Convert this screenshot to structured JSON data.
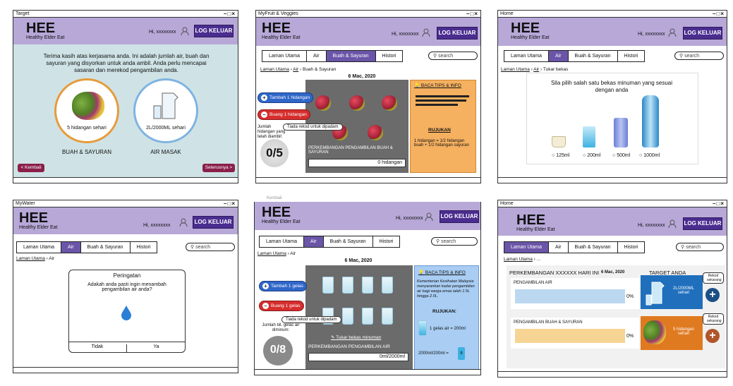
{
  "app": {
    "logo": "HEE",
    "tagline": "Healthy Elder Eat",
    "greeting": "Hi, xxxxxxxx",
    "logout": "LOG KELUAR",
    "search": "search"
  },
  "tabs": [
    "Laman Utama",
    "Air",
    "Buah & Sayuran",
    "Histori"
  ],
  "colors": {
    "header": "#b7a8d8",
    "accent": "#4a2d8f",
    "tab_active": "#6a55a8",
    "add_green_bg": "#2f66c9",
    "minus_red": "#d62d2d",
    "info_orange": "#f5b060",
    "info_blue": "#a9cdf3",
    "dark_panel": "#6b6b6b",
    "bar_blue": "#bcd8f0",
    "bar_orange": "#f6d494",
    "target_water": "#1f6fbd",
    "target_fruit": "#e07a20"
  },
  "w1": {
    "title": "Target",
    "intro": "Terima kasih atas kerjasama anda. Ini adalah jumlah air, buah dan sayuran yang disyorkan untuk anda ambil. Anda perlu mencapai sasaran dan merekod pengambilan anda.",
    "fruit_circle": "5 hidangan sehari",
    "water_circle": "2L/2000ML sehari",
    "fruit_label": "BUAH & SAYURAN",
    "water_label": "AIR MASAK",
    "back": "< Kembali",
    "next": "Seterusnya >"
  },
  "w2": {
    "title": "MyFruit & Veggies",
    "crumb_home": "Laman Utama",
    "crumb_air": "Air",
    "crumb_here": "Buah & Sayuran",
    "date": "6 Mac, 2020",
    "add": "Tambah 1 hidangan",
    "remove": "Buang 1 hidangan",
    "count_label": "Jumlah hidangan yang telah diambil:",
    "tooltip": "Tiada rekod untuk dipadam",
    "count": "0/5",
    "progress_label": "PERKEMBANGAN PENGAMBILAN BUAH & SAYURAN",
    "progress_value": "0 hidangan",
    "tips": "BACA TIPS & INFO",
    "ref_title": "RUJUKAN",
    "ref_text": "1 hidangan = 1/2 hidangan buah + 1/2 hidangan sayuran"
  },
  "w3": {
    "title": "Home",
    "crumb_home": "Laman Utama",
    "crumb_air": "Air",
    "crumb_here": "Tukar bekas",
    "prompt": "Sila pilih salah satu bekas minuman yang sesuai dengan anda",
    "options": [
      "125ml",
      "200ml",
      "500ml",
      "1000ml"
    ]
  },
  "w4": {
    "title": "MyWater",
    "crumb_home": "Laman Utama",
    "crumb_here": "Air",
    "dialog_title": "Peringatan",
    "dialog_text": "Adakah anda pasti ingin menambah pengambilan air anda?",
    "no": "Tidak",
    "yes": "Ya"
  },
  "w5": {
    "top_text": "Kembali",
    "crumb_home": "Laman Utama",
    "crumb_here": "Air",
    "date": "6 Mac, 2020",
    "add": "Tambah 1 gelas",
    "remove": "Buang 1 gelas",
    "tooltip": "Tiada rekod untuk dipadam",
    "count_label": "Jumlah bil. gelas air diminum:",
    "count": "0/8",
    "change": "Tukar bekas minuman",
    "progress_label": "PERKEMBANGAN PENGAMBILAN AIR",
    "progress_value": "0ml/2000ml",
    "tips": "BACA TIPS & INFO",
    "info_text": "Kementerian Kesihatan Malaysia menyarankan kadar pengambilan air bagi warga emas ialah 1.5L hingga 2.0L.",
    "ref_title": "RUJUKAN:",
    "ref_line1": "1 gelas air = 200ml",
    "ref_line2": "2000ml/200ml =",
    "ref_num": "8"
  },
  "w6": {
    "title": "Home",
    "crumb_home": "Laman Utama",
    "crumb_here": "...",
    "heading": "PERKEMBANGAN XXXXXX HARI INI",
    "date": "6 Mac, 2020",
    "target_heading": "TARGET ANDA",
    "water_label": "PENGAMBILAN AIR",
    "water_pct": "0%",
    "water_target": "2L/2000ML sehari",
    "fruit_label": "PENGAMBILAN BUAH & SAYURAN",
    "fruit_pct": "0%",
    "fruit_target": "5 hidangan sehari",
    "record_now": "Rekod sekarang",
    "water_progress": 0,
    "fruit_progress": 0
  }
}
